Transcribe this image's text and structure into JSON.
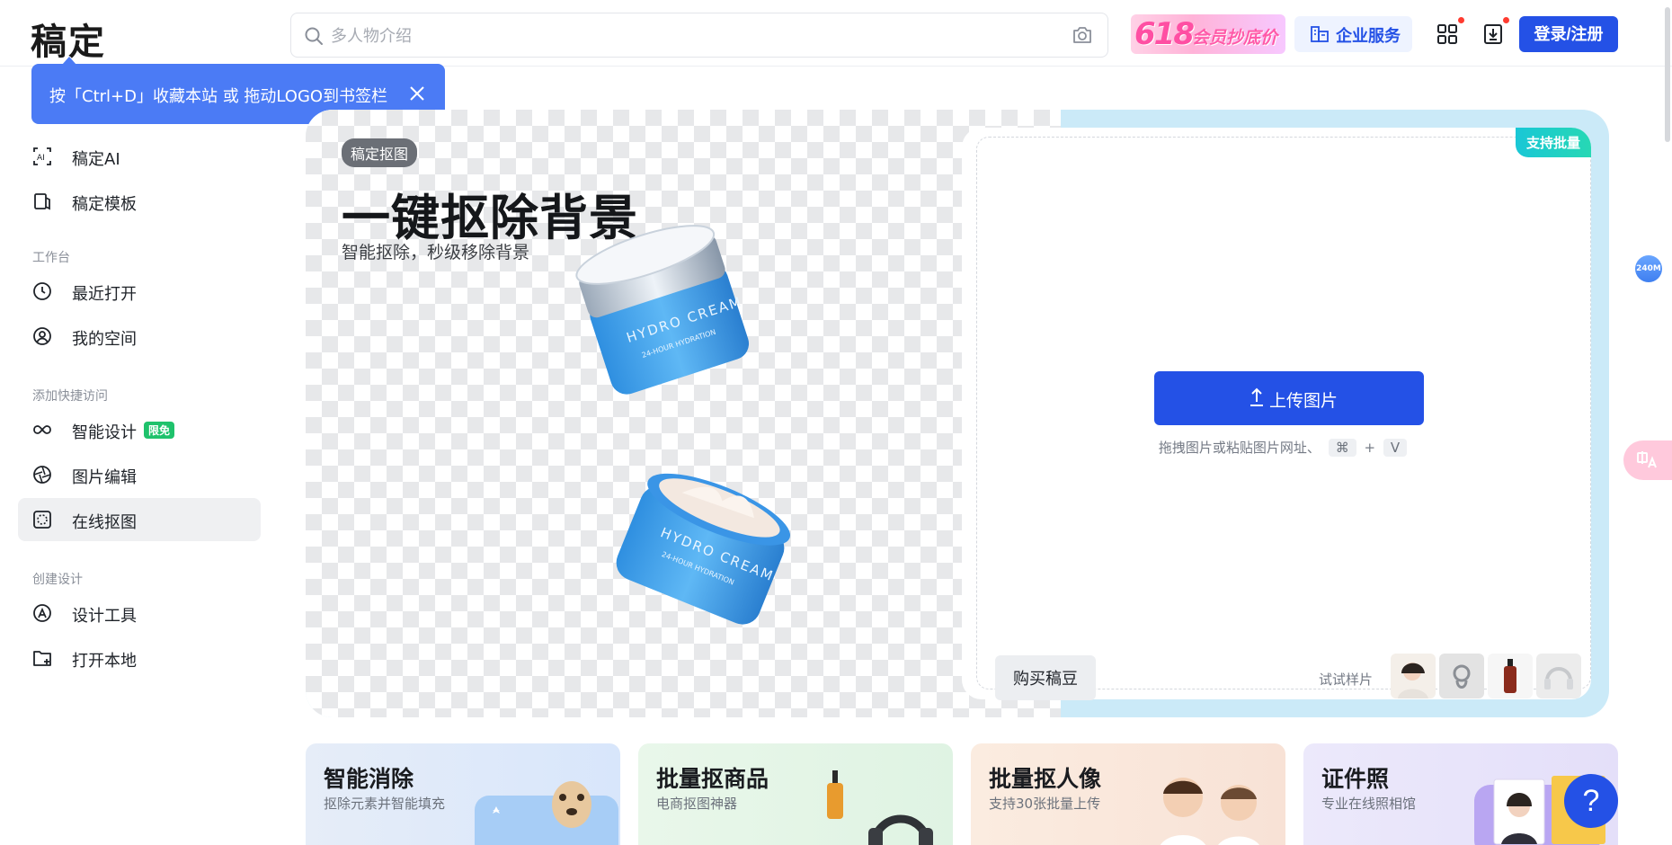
{
  "app": {
    "logo": "稿定"
  },
  "header": {
    "search_placeholder": "多人物介绍",
    "promo_number": "618",
    "promo_text": "会员抄底价",
    "enterprise_label": "企业服务",
    "login_label": "登录/注册"
  },
  "tooltip": {
    "text": "按「Ctrl+D」收藏本站 或 拖动LOGO到书签栏"
  },
  "sidebar": {
    "top_items": [
      {
        "label": "稿定AI"
      },
      {
        "label": "稿定模板"
      }
    ],
    "workspace_title": "工作台",
    "workspace_items": [
      {
        "label": "最近打开"
      },
      {
        "label": "我的空间"
      }
    ],
    "quick_title": "添加快捷访问",
    "quick_items": [
      {
        "label": "智能设计",
        "badge": "限免"
      },
      {
        "label": "图片编辑"
      },
      {
        "label": "在线抠图"
      }
    ],
    "create_title": "创建设计",
    "create_items": [
      {
        "label": "设计工具"
      },
      {
        "label": "打开本地"
      }
    ]
  },
  "hero": {
    "tag": "稿定抠图",
    "title": "一键抠除背景",
    "subtitle": "智能抠除，秒级移除背景",
    "batch_tag": "支持批量",
    "upload_label": "上传图片",
    "upload_hint": "拖拽图片或粘贴图片网址、",
    "key1": "⌘",
    "plus": "+",
    "key2": "V",
    "buy_label": "购买稿豆",
    "try_label": "试试样片"
  },
  "features": [
    {
      "title": "智能消除",
      "subtitle": "抠除元素并智能填充"
    },
    {
      "title": "批量抠商品",
      "subtitle": "电商抠图神器"
    },
    {
      "title": "批量抠人像",
      "subtitle": "支持30张批量上传"
    },
    {
      "title": "证件照",
      "subtitle": "专业在线照相馆"
    }
  ],
  "floating": {
    "memory_badge": "240M",
    "help": "?"
  },
  "colors": {
    "primary": "#2451e6",
    "tooltip": "#4b7bf5",
    "badge_green": "#1fc26c",
    "hero_blue": "#cbeaf8"
  }
}
